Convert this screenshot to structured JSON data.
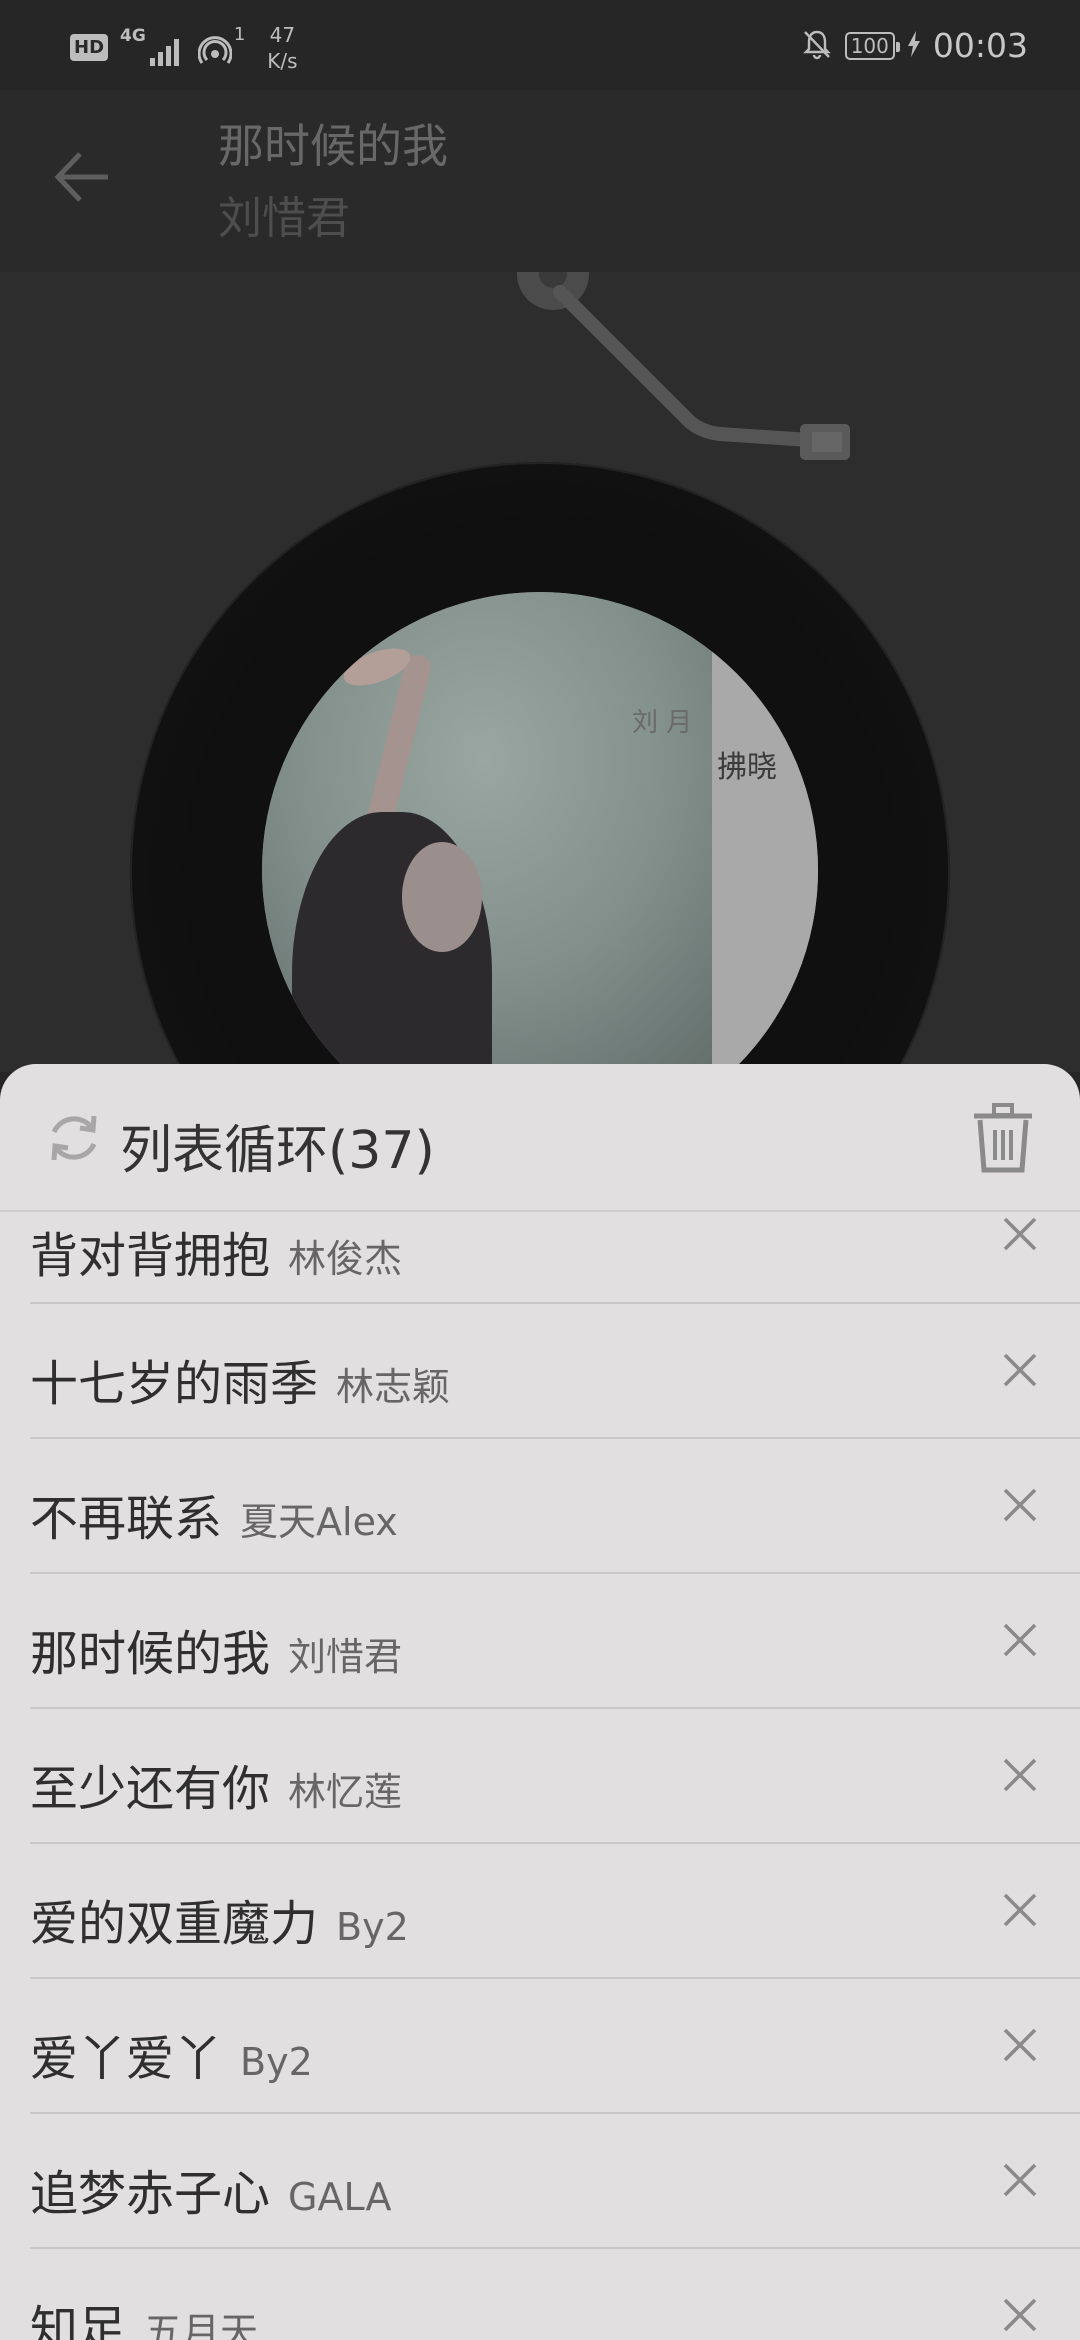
{
  "status_bar": {
    "hd": "HD",
    "network": "4G",
    "hotspot_count": "1",
    "speed_value": "47",
    "speed_unit": "K/s",
    "battery": "100",
    "time": "00:03"
  },
  "header": {
    "title": "那时候的我",
    "artist": "刘惜君"
  },
  "cover_art": {
    "text_small": "刘  月",
    "text_large": "拂晓"
  },
  "playlist": {
    "mode_label": "列表循环(37)",
    "items": [
      {
        "title": "背对背拥抱",
        "artist": "林俊杰"
      },
      {
        "title": "十七岁的雨季",
        "artist": "林志颖"
      },
      {
        "title": "不再联系",
        "artist": "夏天Alex"
      },
      {
        "title": "那时候的我",
        "artist": "刘惜君"
      },
      {
        "title": "至少还有你",
        "artist": "林忆莲"
      },
      {
        "title": "爱的双重魔力",
        "artist": "By2"
      },
      {
        "title": "爱丫爱丫",
        "artist": "By2"
      },
      {
        "title": "追梦赤子心",
        "artist": "GALA"
      },
      {
        "title": "知足",
        "artist": "五月天"
      }
    ]
  },
  "colors": {
    "overlay_bg": "#262626",
    "sheet_bg": "#e1dfe0",
    "text_primary": "#2f2f2f",
    "text_secondary": "#666666",
    "icon_gray": "#8a8a8a"
  }
}
